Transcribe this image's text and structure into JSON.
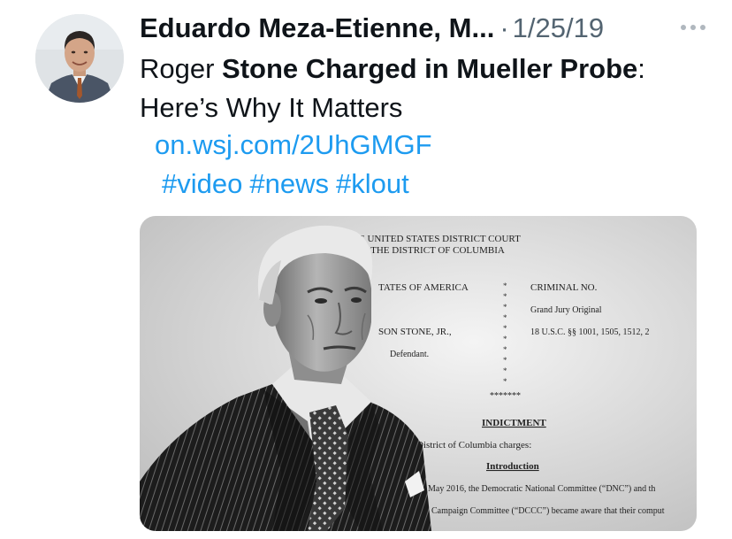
{
  "tweet": {
    "author": {
      "name": "Eduardo Meza-Etienne, M...",
      "avatar_icon": "profile-photo"
    },
    "separator": "·",
    "date": "1/25/19",
    "more_icon": "more-horizontal-icon",
    "text": {
      "part1": "Roger ",
      "bold1": "Stone Charged in Mueller Probe",
      "part2": ":",
      "line2": "Here’s Why It Matters"
    },
    "link": "on.wsj.com/2UhGMGF",
    "hashtags": [
      "#video",
      "#news",
      "#klout"
    ],
    "media": {
      "type": "photo",
      "document": {
        "court_line1": "IN THE UNITED STATES DISTRICT COURT",
        "court_line2": "FOR THE DISTRICT OF COLUMBIA",
        "party": "TATES OF AMERICA",
        "criminal_no": "CRIMINAL NO.",
        "grand_jury": "Grand Jury Original",
        "defendant_name": "SON STONE, JR.,",
        "statute": "18 U.S.C. §§ 1001, 1505, 1512, 2",
        "defendant_label": "Defendant.",
        "stars": "*******",
        "indictment": "INDICTMENT",
        "charges": "District of Columbia charges:",
        "introduction": "Introduction",
        "para_line1": "May 2016, the Democratic National Committee (“DNC”) and th",
        "para_line2": "Campaign Committee (“DCCC”) became aware that their comput"
      }
    }
  },
  "colors": {
    "text": "#0f1419",
    "secondary": "#536471",
    "link": "#1d9bf0"
  }
}
